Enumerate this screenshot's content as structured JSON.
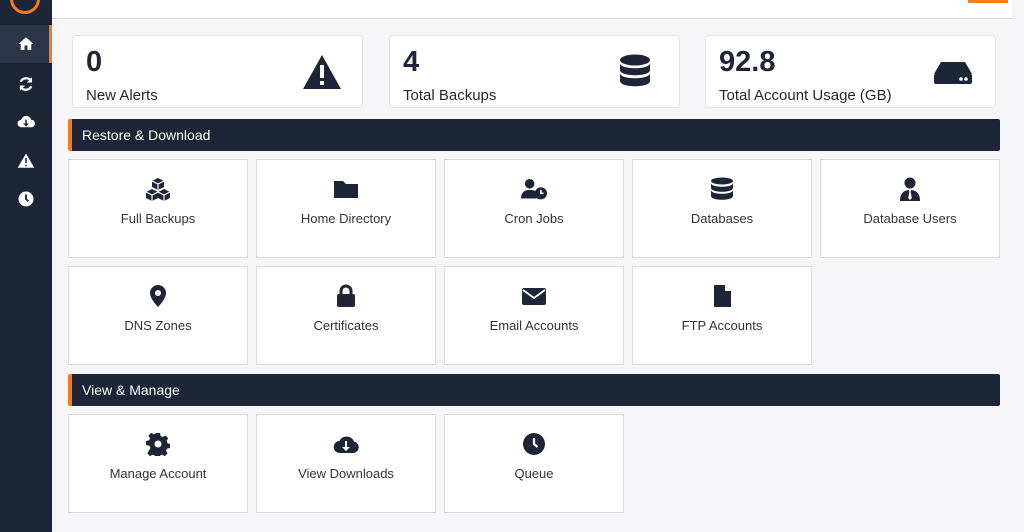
{
  "stats": [
    {
      "value": "0",
      "label": "New Alerts",
      "icon": "warning-icon"
    },
    {
      "value": "4",
      "label": "Total Backups",
      "icon": "database-icon"
    },
    {
      "value": "92.8",
      "label": "Total Account Usage (GB)",
      "icon": "hard-drive-icon"
    }
  ],
  "sections": {
    "restore": "Restore & Download",
    "view": "View & Manage"
  },
  "tiles": {
    "full_backups": "Full Backups",
    "home_directory": "Home Directory",
    "cron_jobs": "Cron Jobs",
    "databases": "Databases",
    "database_users": "Database Users",
    "dns_zones": "DNS Zones",
    "certificates": "Certificates",
    "email_accounts": "Email Accounts",
    "ftp_accounts": "FTP Accounts",
    "manage_account": "Manage Account",
    "view_downloads": "View Downloads",
    "queue": "Queue"
  },
  "sidebar": {
    "items": [
      "home-icon",
      "refresh-icon",
      "cloud-download-icon",
      "warning-icon",
      "clock-icon"
    ]
  },
  "colors": {
    "accent": "#f47b20",
    "dark": "#1e2536"
  }
}
